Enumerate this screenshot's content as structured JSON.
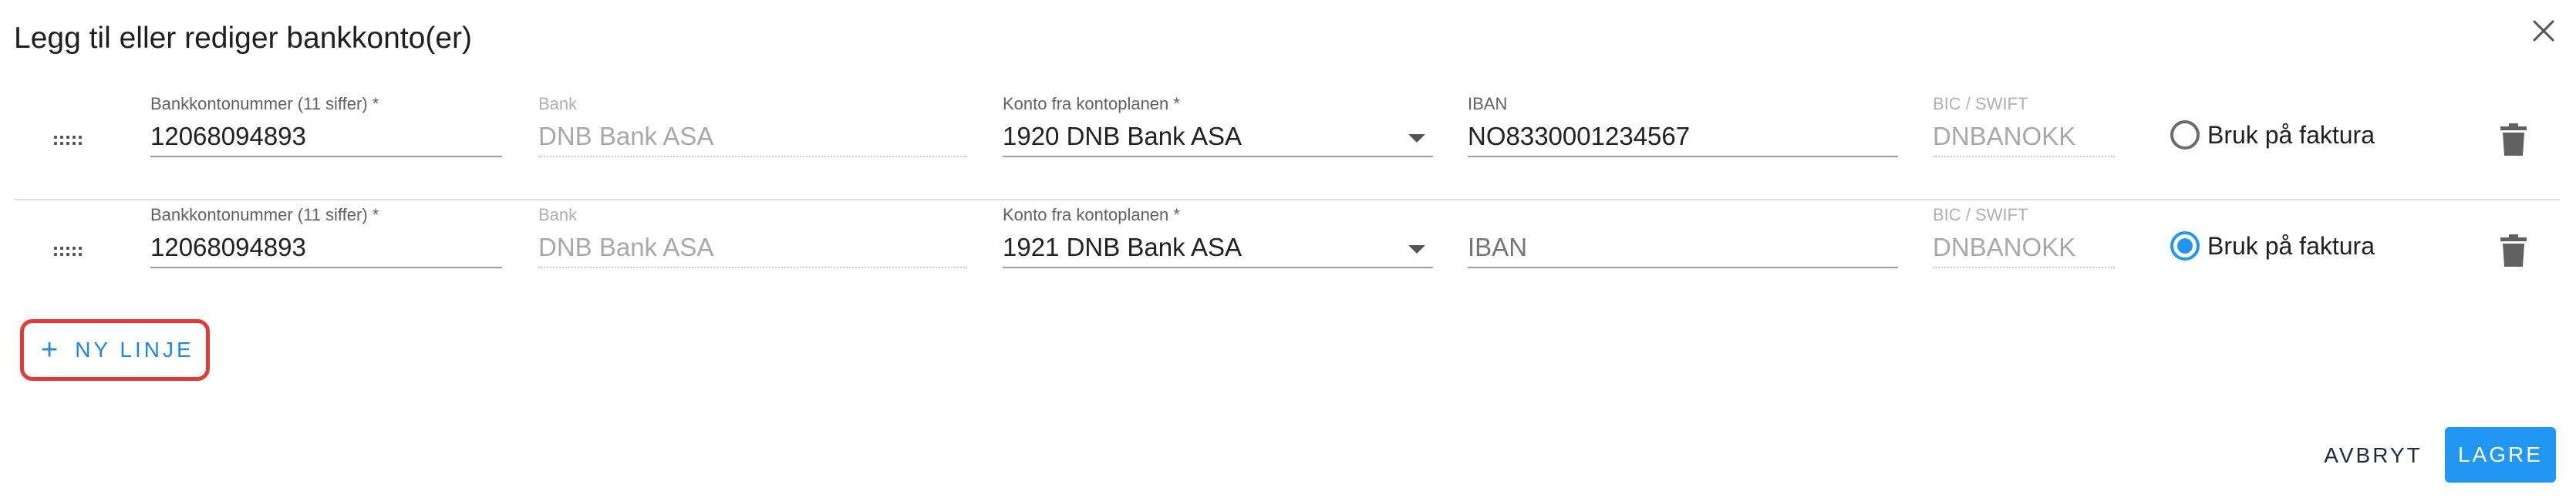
{
  "dialog": {
    "title": "Legg til eller rediger bankkonto(er)"
  },
  "rows": [
    {
      "account_label": "Bankkontonummer (11 siffer) *",
      "account_value": "12068094893",
      "bank_label": "Bank",
      "bank_value": "DNB Bank ASA",
      "konto_label": "Konto fra kontoplanen *",
      "konto_value": "1920 DNB Bank ASA",
      "iban_label": "IBAN",
      "iban_value": "NO8330001234567",
      "bic_label": "BIC / SWIFT",
      "bic_value": "DNBANOKK",
      "radio_label": "Bruk på faktura",
      "radio_checked": false
    },
    {
      "account_label": "Bankkontonummer (11 siffer) *",
      "account_value": "12068094893",
      "bank_label": "Bank",
      "bank_value": "DNB Bank ASA",
      "konto_label": "Konto fra kontoplanen *",
      "konto_value": "1921 DNB Bank ASA",
      "iban_label": "",
      "iban_placeholder": "IBAN",
      "bic_label": "BIC / SWIFT",
      "bic_value": "DNBANOKK",
      "radio_label": "Bruk på faktura",
      "radio_checked": true
    }
  ],
  "actions": {
    "new_line": "NY LINJE",
    "cancel": "AVBRYT",
    "save": "LAGRE"
  },
  "colors": {
    "accent": "#2196f3",
    "highlight_border": "#e53935"
  },
  "icons": {
    "close": "close-icon",
    "drag": "drag-handle-icon",
    "delete": "trash-icon",
    "dropdown": "caret-down-icon",
    "add": "plus-icon"
  }
}
